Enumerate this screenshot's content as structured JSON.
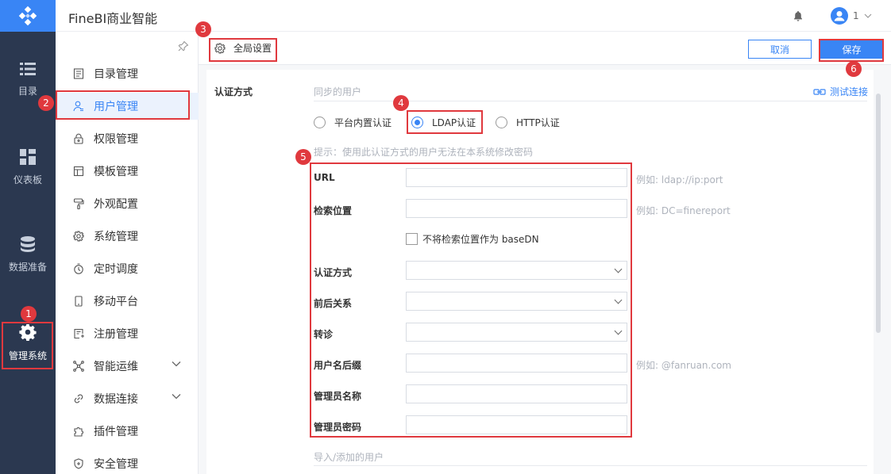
{
  "app": {
    "title": "FineBI商业智能",
    "user": "1"
  },
  "rail": {
    "items": [
      {
        "label": "目录",
        "icon": "list-icon"
      },
      {
        "label": "仪表板",
        "icon": "dashboard-icon"
      },
      {
        "label": "数据准备",
        "icon": "database-icon"
      },
      {
        "label": "管理系统",
        "icon": "gear-icon"
      }
    ]
  },
  "sidebar": {
    "items": [
      {
        "label": "目录管理",
        "icon": "catalog-icon"
      },
      {
        "label": "用户管理",
        "icon": "user-icon",
        "active": true
      },
      {
        "label": "权限管理",
        "icon": "lock-icon"
      },
      {
        "label": "模板管理",
        "icon": "template-icon"
      },
      {
        "label": "外观配置",
        "icon": "brush-icon"
      },
      {
        "label": "系统管理",
        "icon": "gear-icon"
      },
      {
        "label": "定时调度",
        "icon": "timer-icon"
      },
      {
        "label": "移动平台",
        "icon": "mobile-icon"
      },
      {
        "label": "注册管理",
        "icon": "register-icon"
      },
      {
        "label": "智能运维",
        "icon": "network-icon",
        "expandable": true
      },
      {
        "label": "数据连接",
        "icon": "link-icon",
        "expandable": true
      },
      {
        "label": "插件管理",
        "icon": "plugin-icon"
      },
      {
        "label": "安全管理",
        "icon": "shield-icon"
      }
    ]
  },
  "toolbar": {
    "global_settings": "全局设置",
    "cancel": "取消",
    "save": "保存"
  },
  "form": {
    "section_label": "认证方式",
    "sync_users_title": "同步的用户",
    "test_connection": "测试连接",
    "radios": [
      {
        "label": "平台内置认证",
        "checked": false
      },
      {
        "label": "LDAP认证",
        "checked": true
      },
      {
        "label": "HTTP认证",
        "checked": false
      }
    ],
    "tip": "提示：使用此认证方式的用户无法在本系统修改密码",
    "fields": {
      "url": {
        "label": "URL",
        "value": "",
        "example": "例如: ldap://ip:port"
      },
      "search_base": {
        "label": "检索位置",
        "value": "",
        "example": "例如: DC=finereport"
      },
      "no_basedn": {
        "label": "不将检索位置作为 baseDN",
        "checked": false
      },
      "auth_mode": {
        "label": "认证方式",
        "value": ""
      },
      "context": {
        "label": "前后关系",
        "value": ""
      },
      "referral": {
        "label": "转诊",
        "value": ""
      },
      "user_suffix": {
        "label": "用户名后缀",
        "value": "",
        "example": "例如: @fanruan.com"
      },
      "admin_name": {
        "label": "管理员名称",
        "value": ""
      },
      "admin_pwd": {
        "label": "管理员密码",
        "value": ""
      }
    },
    "import_users_title": "导入/添加的用户"
  },
  "annotations": [
    "1",
    "2",
    "3",
    "4",
    "5",
    "6"
  ],
  "colors": {
    "accent": "#3985f5",
    "rail": "#2b3850",
    "annotation": "#e0393e"
  }
}
